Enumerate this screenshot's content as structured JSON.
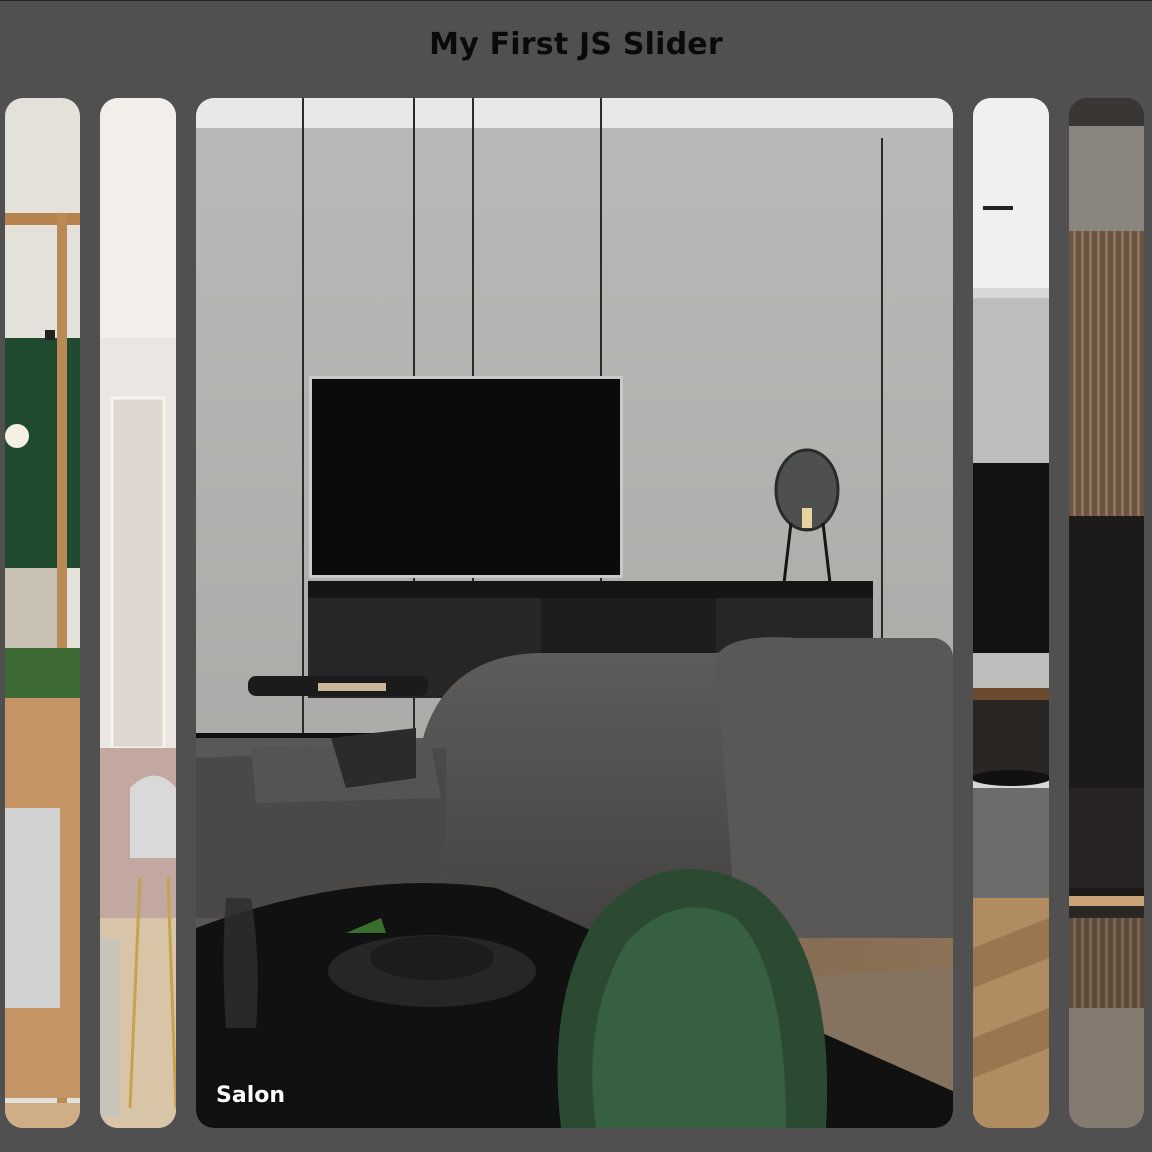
{
  "page": {
    "title": "My First JS Slider"
  },
  "slides": [
    {
      "label": "",
      "active": false,
      "scene": "living room with green wall and wood shelving"
    },
    {
      "label": "",
      "active": false,
      "scene": "dining area with white chairs"
    },
    {
      "label": "Salon",
      "active": true,
      "scene": "living room with TV on textured gray wall, gray sofa, dark dining table and green chair"
    },
    {
      "label": "",
      "active": false,
      "scene": "living room with dark TV wall"
    },
    {
      "label": "",
      "active": false,
      "scene": "wood slat wall panels"
    }
  ],
  "colors": {
    "background": "#505050",
    "title": "#0a0a0a",
    "label": "#ffffff"
  }
}
